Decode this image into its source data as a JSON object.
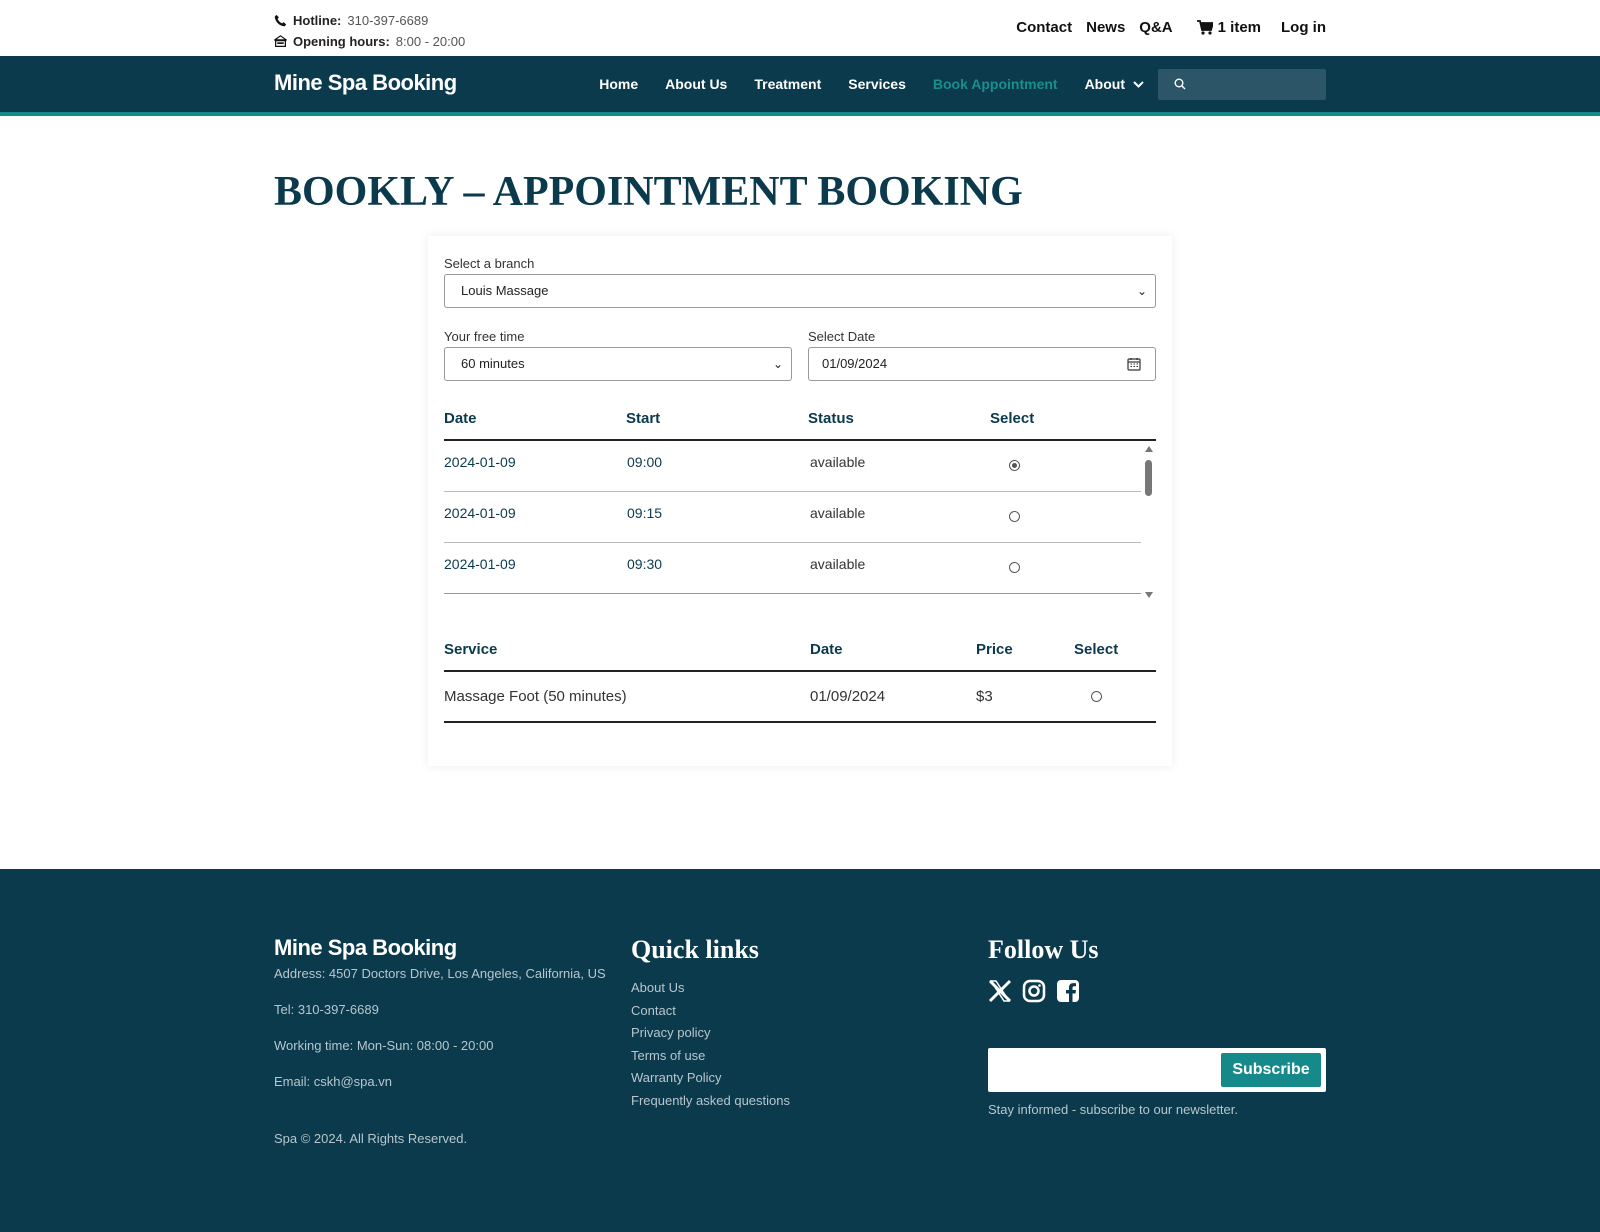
{
  "topbar": {
    "hotline_label": "Hotline:",
    "hotline_value": "310-397-6689",
    "hours_label": "Opening hours:",
    "hours_value": "8:00 - 20:00",
    "links": [
      "Contact",
      "News",
      "Q&A"
    ],
    "cart_label": "1 item",
    "login_label": "Log in"
  },
  "nav": {
    "brand": "Mine Spa Booking",
    "items": [
      "Home",
      "About Us",
      "Treatment",
      "Services",
      "Book Appointment",
      "About"
    ],
    "active_index": 4,
    "search_placeholder": ""
  },
  "page": {
    "title": "BOOKLY – APPOINTMENT BOOKING"
  },
  "form": {
    "branch_label": "Select a branch",
    "branch_value": "Louis Massage",
    "free_time_label": "Your free time",
    "free_time_value": "60 minutes",
    "date_label": "Select Date",
    "date_value": "01/09/2024"
  },
  "slots": {
    "headers": [
      "Date",
      "Start",
      "Status",
      "Select"
    ],
    "rows": [
      {
        "date": "2024-01-09",
        "start": "09:00",
        "status": "available",
        "selected": true
      },
      {
        "date": "2024-01-09",
        "start": "09:15",
        "status": "available",
        "selected": false
      },
      {
        "date": "2024-01-09",
        "start": "09:30",
        "status": "available",
        "selected": false
      }
    ]
  },
  "services": {
    "headers": [
      "Service",
      "Date",
      "Price",
      "Select"
    ],
    "rows": [
      {
        "service": "Massage Foot (50 minutes)",
        "date": "01/09/2024",
        "price": "$3",
        "selected": false
      }
    ]
  },
  "footer": {
    "brand": "Mine Spa Booking",
    "address": "Address: 4507 Doctors Drive, Los Angeles, California, US",
    "tel": "Tel: 310-397-6689",
    "working_time": "Working time: Mon-Sun: 08:00 - 20:00",
    "email": "Email: cskh@spa.vn",
    "copyright": "Spa © 2024. All Rights Reserved.",
    "quick_links_title": "Quick links",
    "quick_links": [
      "About Us",
      "Contact",
      "Privacy policy",
      "Terms of use",
      "Warranty Policy",
      "Frequently asked questions"
    ],
    "follow_title": "Follow Us",
    "social_icons": [
      "x-twitter-icon",
      "instagram-icon",
      "facebook-icon"
    ],
    "subscribe_label": "Subscribe",
    "newsletter_note": "Stay informed - subscribe to our newsletter."
  },
  "colors": {
    "primary": "#0b3a4d",
    "accent": "#168a8a"
  }
}
